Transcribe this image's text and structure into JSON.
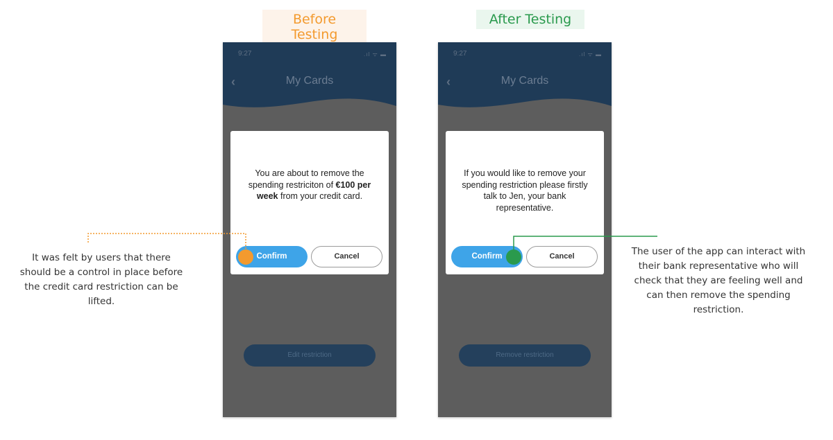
{
  "labels": {
    "before": "Before Testing",
    "after": "After Testing"
  },
  "phones": [
    {
      "status_time": "9:27",
      "status_icons": ".ıl ᯤ ▬",
      "title": "My Cards",
      "message_before": "You are about to remove the spending restriciton of ",
      "message_bold": "€100 per week",
      "message_after": " from your credit card.",
      "confirm_label": "Confirm",
      "cancel_label": "Cancel",
      "bottom_button": "Edit restriction"
    },
    {
      "status_time": "9:27",
      "status_icons": ".ıl ᯤ ▬",
      "title": "My Cards",
      "message": "If you would like to remove your spending restriction please firstly talk to Jen, your bank representative.",
      "confirm_label": "Confirm",
      "cancel_label": "Cancel",
      "bottom_button": "Remove restriction"
    }
  ],
  "notes": {
    "left": "It was felt by users that there should be a control in place before the credit card restriction can be lifted.",
    "right": "The user of the app can interact with their bank representative who will check that they are feeling well and can then remove the spending restriction."
  },
  "colors": {
    "before_accent": "#f39a2e",
    "after_accent": "#2a9a4d",
    "header_navy": "#1f3b57",
    "overlay_gray": "#5d5d5d",
    "confirm_blue": "#3ea4e8"
  },
  "icons": {
    "back": "back-chevron-icon"
  }
}
